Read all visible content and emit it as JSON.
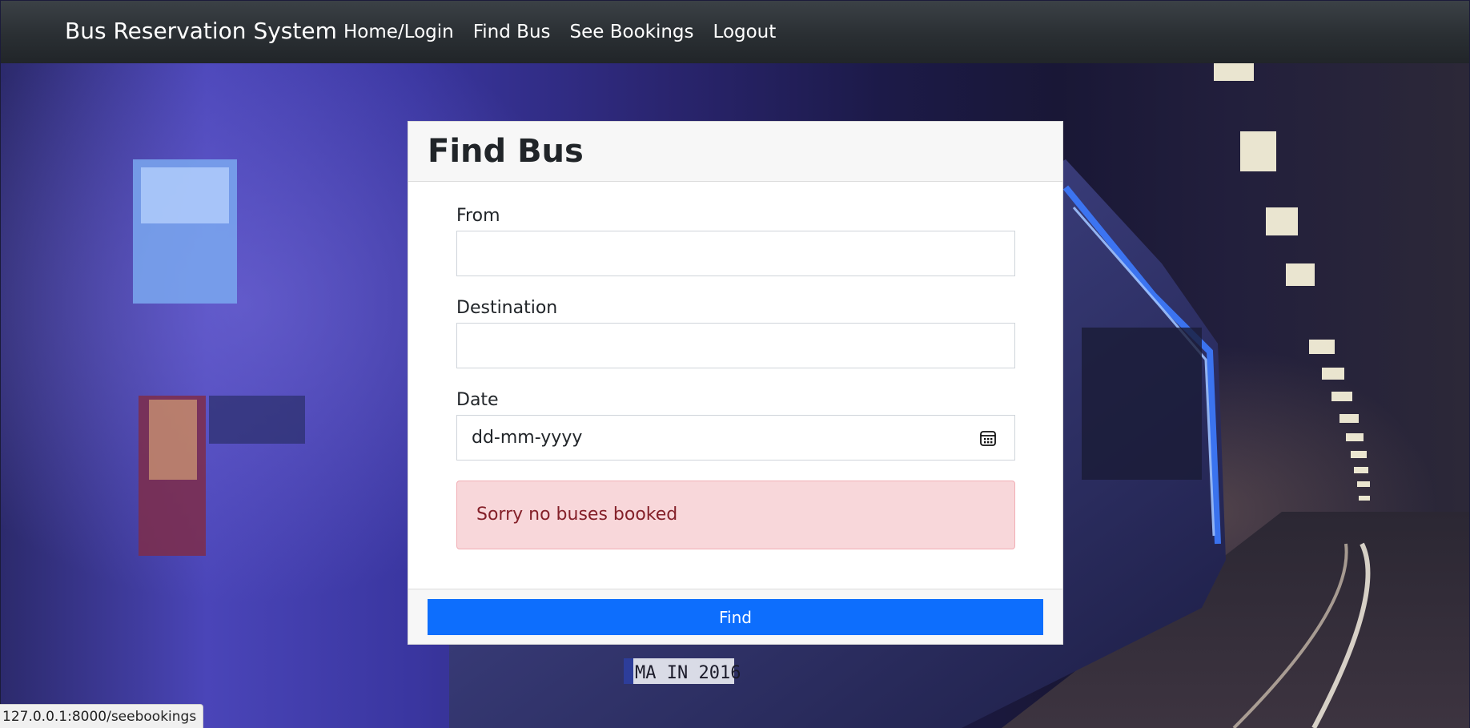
{
  "navbar": {
    "brand": "Bus Reservation System",
    "links": [
      {
        "label": "Home/Login"
      },
      {
        "label": "Find Bus"
      },
      {
        "label": "See Bookings"
      },
      {
        "label": "Logout"
      }
    ]
  },
  "card": {
    "title": "Find Bus",
    "fields": {
      "from": {
        "label": "From",
        "value": ""
      },
      "destination": {
        "label": "Destination",
        "value": ""
      },
      "date": {
        "label": "Date",
        "placeholder": "dd-mm-yyyy"
      }
    },
    "alert": {
      "text": "Sorry no buses booked",
      "color": "#842029",
      "background": "#f8d7da"
    },
    "find_button": {
      "label": "Find",
      "color": "#0d6efd"
    }
  },
  "background": {
    "plate_text": "MA IN 2016"
  },
  "status_bar": {
    "url": "127.0.0.1:8000/seebookings"
  },
  "icons": {
    "date_picker": "calendar-icon"
  }
}
